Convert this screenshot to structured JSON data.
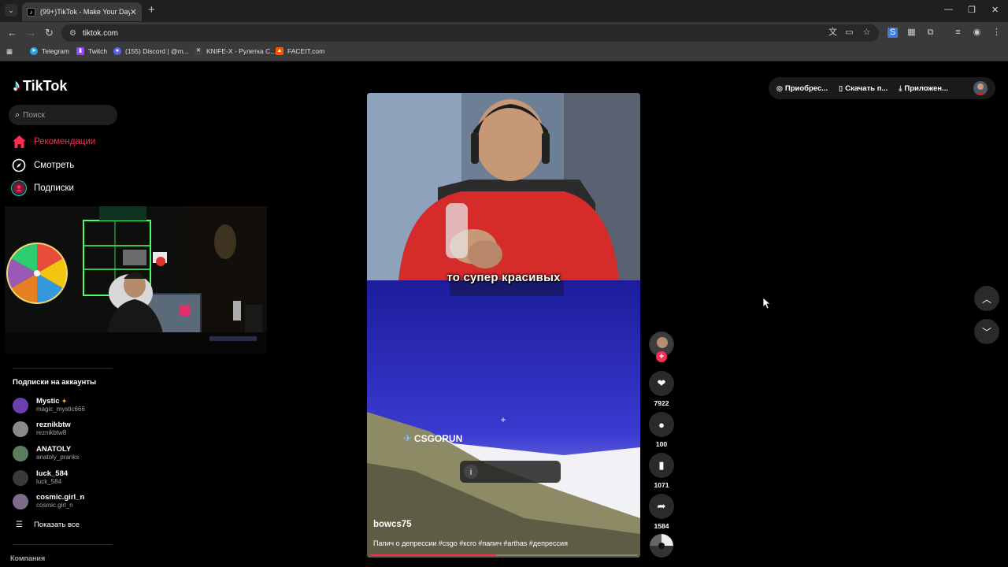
{
  "browser": {
    "tab_title": "(99+)TikTok - Make Your Day",
    "url": "tiktok.com",
    "bookmarks": [
      {
        "label": "Telegram",
        "color": "#2aa3df"
      },
      {
        "label": "Twitch",
        "color": "#9146ff"
      },
      {
        "label": "(155) Discord | @m...",
        "color": "#5865f2"
      },
      {
        "label": "KNIFE-X - Рулетка С...",
        "color": "#888888"
      },
      {
        "label": "FACEIT.com",
        "color": "#ff5500"
      }
    ]
  },
  "tiktok": {
    "logo_text": "TikTok",
    "search_placeholder": "Поиск",
    "nav": [
      {
        "label": "Рекомендации",
        "icon": "home-icon",
        "active": true
      },
      {
        "label": "Смотреть",
        "icon": "compass-icon",
        "active": false
      },
      {
        "label": "Подписки",
        "icon": "following-icon",
        "active": false
      }
    ],
    "subscriptions_title": "Подписки на аккаунты",
    "subscriptions": [
      {
        "name": "Mystic",
        "handle": "magic_mystic666",
        "color": "#6a3fb0"
      },
      {
        "name": "reznikbtw",
        "handle": "reznikbtw8",
        "color": "#8a8a8a"
      },
      {
        "name": "ANATOLY",
        "handle": "anatoly_pranks",
        "color": "#5e7d5e"
      },
      {
        "name": "luck_584",
        "handle": "luck_584",
        "color": "#3a3a3a"
      },
      {
        "name": "cosmic.girl_n",
        "handle": "cosmic.girl_n",
        "color": "#7d6b8a"
      }
    ],
    "show_all_label": "Показать все",
    "company_label": "Компания",
    "top_actions": [
      {
        "label": "Приобрес...",
        "icon": "coin-icon"
      },
      {
        "label": "Скачать п...",
        "icon": "phone-icon"
      },
      {
        "label": "Приложен...",
        "icon": "download-icon"
      }
    ],
    "video": {
      "caption": "то супер красивых",
      "overlay_text": "CSGORUN",
      "author": "bowcs75",
      "description": "Папич о депрессии #csgo #ксго #папич #arthas #депрессия",
      "progress": 0.47,
      "likes": "7922",
      "comments": "100",
      "saves": "1071",
      "shares": "1584"
    }
  }
}
